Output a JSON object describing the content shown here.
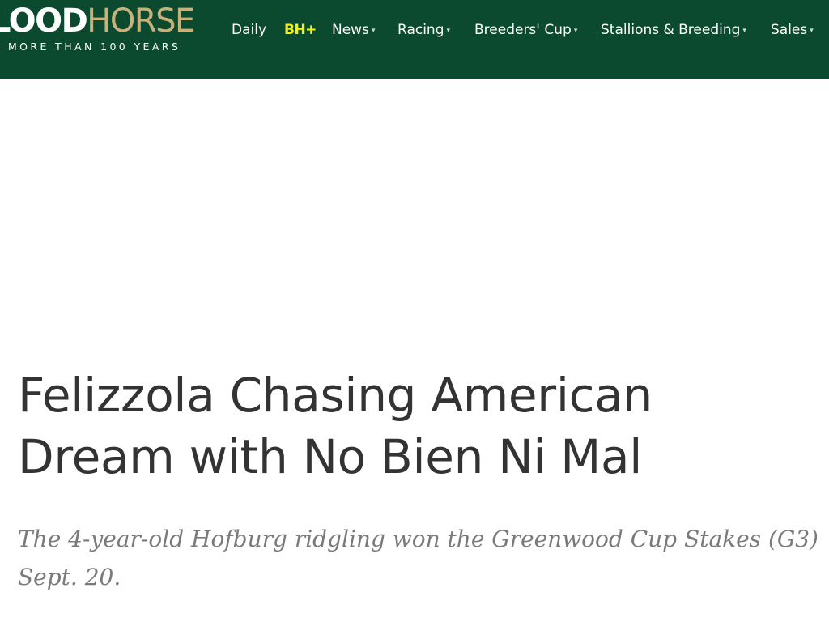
{
  "header": {
    "logo": {
      "word_part1": "LOOD",
      "word_part2": "HORSE",
      "tagline": "MORE THAN 100 YEARS"
    },
    "nav": [
      {
        "label": "Daily",
        "has_dropdown": false
      },
      {
        "label": "BH+",
        "has_dropdown": false,
        "highlight": true
      },
      {
        "label": "News",
        "has_dropdown": true
      },
      {
        "label": "Racing",
        "has_dropdown": true
      },
      {
        "label": "Breeders' Cup",
        "has_dropdown": true
      },
      {
        "label": "Stallions & Breeding",
        "has_dropdown": true
      },
      {
        "label": "Sales",
        "has_dropdown": true
      }
    ],
    "dropdown_glyph": "▾"
  },
  "article": {
    "headline": "Felizzola Chasing American Dream with No Bien Ni Mal",
    "deck": "The 4-year-old Hofburg ridgling won the Greenwood Cup Stakes (G3) Sept. 20."
  },
  "colors": {
    "header_bg": "#0b4a2f",
    "logo_gold": "#c8b27a",
    "bh_plus": "#f4f40a",
    "headline_text": "#333333",
    "deck_text": "#7a7a7a"
  }
}
